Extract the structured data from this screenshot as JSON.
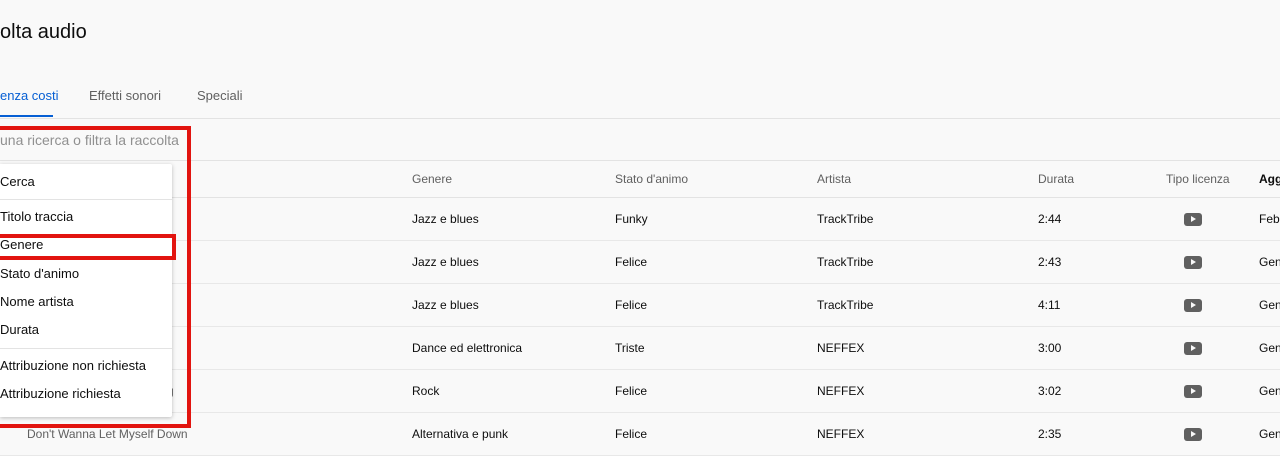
{
  "page": {
    "title": "olta audio"
  },
  "tabs": [
    {
      "label": "enza costi",
      "active": true
    },
    {
      "label": "Effetti sonori",
      "active": false
    },
    {
      "label": "Speciali",
      "active": false
    }
  ],
  "search": {
    "placeholder": "una ricerca o filtra la raccolta",
    "value": ""
  },
  "table": {
    "headers": {
      "genre": "Genere",
      "mood": "Stato d'animo",
      "artist": "Artista",
      "duration": "Durata",
      "license": "Tipo licenza",
      "updated": "Aggi"
    },
    "rows": [
      {
        "title": "",
        "genre": "Jazz e blues",
        "mood": "Funky",
        "artist": "TrackTribe",
        "duration": "2:44",
        "license_icon": "youtube-icon",
        "date": "Feb"
      },
      {
        "title": "",
        "genre": "Jazz e blues",
        "mood": "Felice",
        "artist": "TrackTribe",
        "duration": "2:43",
        "license_icon": "youtube-icon",
        "date": "Gen"
      },
      {
        "title": "",
        "genre": "Jazz e blues",
        "mood": "Felice",
        "artist": "TrackTribe",
        "duration": "4:11",
        "license_icon": "youtube-icon",
        "date": "Gen"
      },
      {
        "title": "",
        "genre": "Dance ed elettronica",
        "mood": "Triste",
        "artist": "NEFFEX",
        "duration": "3:00",
        "license_icon": "youtube-icon",
        "date": "Gen"
      },
      {
        "title": "g",
        "genre": "Rock",
        "mood": "Felice",
        "artist": "NEFFEX",
        "duration": "3:02",
        "license_icon": "youtube-icon",
        "date": "Gen"
      },
      {
        "title": "Don't Wanna Let Myself Down",
        "genre": "Alternativa e punk",
        "mood": "Felice",
        "artist": "NEFFEX",
        "duration": "2:35",
        "license_icon": "youtube-icon",
        "date": "Gen"
      }
    ]
  },
  "filter_menu": {
    "items": [
      {
        "label": "Cerca"
      },
      {
        "label": "Titolo traccia"
      },
      {
        "label": "Genere",
        "highlighted": true
      },
      {
        "label": "Stato d'animo"
      },
      {
        "label": "Nome artista"
      },
      {
        "label": "Durata"
      },
      {
        "label": "Attribuzione non richiesta"
      },
      {
        "label": "Attribuzione richiesta"
      }
    ]
  },
  "colors": {
    "accent": "#065fd4",
    "highlight": "#e2140f",
    "background": "#f9f9f9"
  }
}
